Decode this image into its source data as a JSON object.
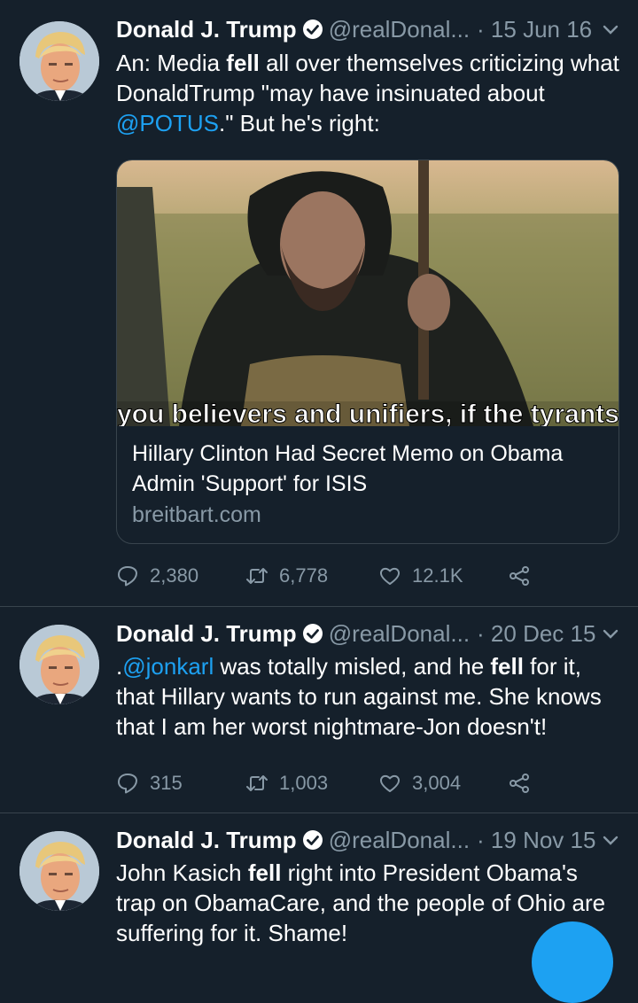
{
  "accent_color": "#1da1f2",
  "background_color": "#15202b",
  "tweets": [
    {
      "name": "Donald J. Trump",
      "handle": "@realDonal...",
      "date": "· 15 Jun 16",
      "text_parts": [
        "An: Media ",
        "fell",
        " all over themselves criticizing what DonaldTrump \"may have insinuated about ",
        "@POTUS",
        ".\" But he's right:"
      ],
      "card": {
        "image_caption": "you believers and unifiers, if the tyrants hav",
        "title": "Hillary Clinton Had Secret Memo on Obama Admin 'Support' for ISIS",
        "domain": "breitbart.com"
      },
      "replies": "2,380",
      "retweets": "6,778",
      "likes": "12.1K"
    },
    {
      "name": "Donald J. Trump",
      "handle": "@realDonal...",
      "date": "· 20 Dec 15",
      "text_parts": [
        ".",
        "@jonkarl",
        " was totally misled, and he ",
        "fell",
        " for it, that Hillary wants to run against me. She knows that I am her worst nightmare-Jon doesn't!"
      ],
      "replies": "315",
      "retweets": "1,003",
      "likes": "3,004"
    },
    {
      "name": "Donald J. Trump",
      "handle": "@realDonal...",
      "date": "· 19 Nov 15",
      "text_parts": [
        "John Kasich ",
        "fell",
        " right into President Obama's trap on ObamaCare, and the people of Ohio are suffering for it. Shame!"
      ]
    }
  ],
  "icons": [
    "verified-badge-icon",
    "chevron-down-icon",
    "reply-icon",
    "retweet-icon",
    "like-icon",
    "share-icon"
  ]
}
